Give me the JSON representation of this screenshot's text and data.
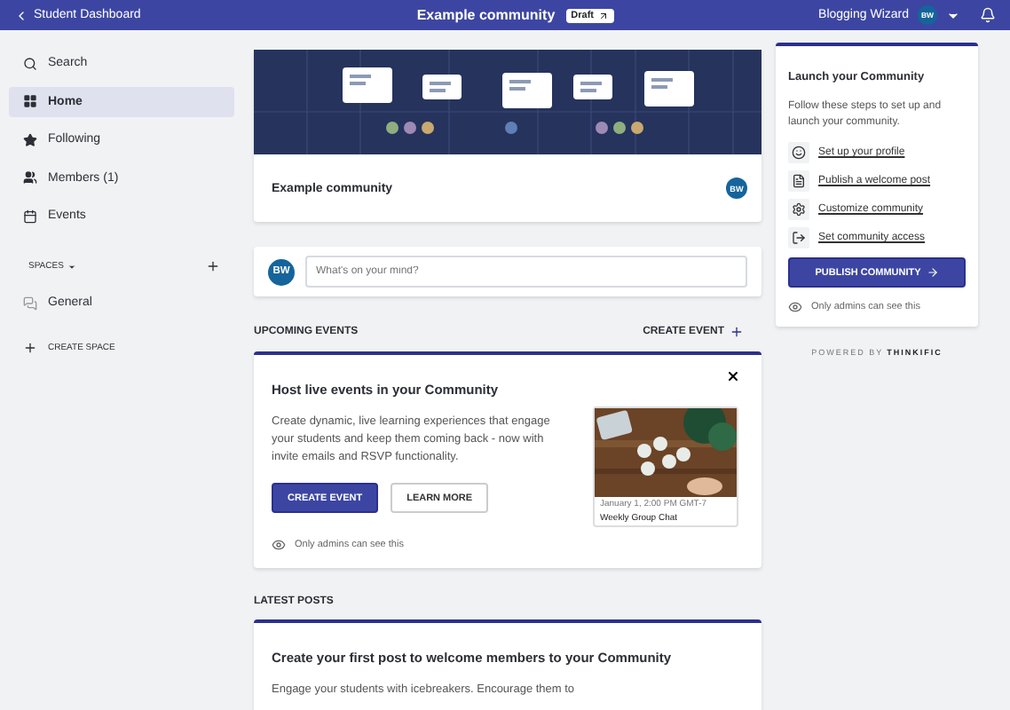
{
  "topbar": {
    "back": "Student Dashboard",
    "title": "Example community",
    "badge": "Draft",
    "user": "Blogging Wizard",
    "avatar": "BW"
  },
  "sidebar": {
    "items": [
      {
        "label": "Search",
        "selected": false
      },
      {
        "label": "Home",
        "selected": true
      },
      {
        "label": "Following",
        "selected": false
      },
      {
        "label": "Members",
        "count": "(1)",
        "selected": false
      },
      {
        "label": "Events",
        "selected": false
      }
    ],
    "spaces_label": "SPACES",
    "spaces": [
      {
        "label": "General",
        "selected": false
      }
    ],
    "create_space": "CREATE SPACE"
  },
  "community": {
    "name": "Example community",
    "avatar": "BW"
  },
  "composer": {
    "avatar": "BW",
    "placeholder": "What's on your mind?"
  },
  "events": {
    "heading": "UPCOMING EVENTS",
    "create": "CREATE EVENT",
    "card": {
      "title": "Host live events in your Community",
      "text": "Create dynamic, live learning experiences that engage your students and keep them coming back - now with invite emails and RSVP functionality.",
      "primary": "CREATE EVENT",
      "secondary": "LEARN MORE",
      "note": "Only admins can see this",
      "preview_date": "January 1, 2:00 PM GMT-7",
      "preview_title": "Weekly Group Chat"
    }
  },
  "posts": {
    "heading": "LATEST POSTS",
    "card": {
      "title": "Create your first post to welcome members to your Community",
      "text": "Engage your students with icebreakers. Encourage them to"
    }
  },
  "launch": {
    "title": "Launch your Community",
    "text": "Follow these steps to set up and launch your community.",
    "steps": [
      {
        "label": "Set up your profile"
      },
      {
        "label": "Publish a welcome post"
      },
      {
        "label": "Customize community"
      },
      {
        "label": "Set community access"
      }
    ],
    "button": "PUBLISH COMMUNITY",
    "note": "Only admins can see this"
  },
  "powered": {
    "prefix": "POWERED BY",
    "brand": "THINKIFIC"
  }
}
